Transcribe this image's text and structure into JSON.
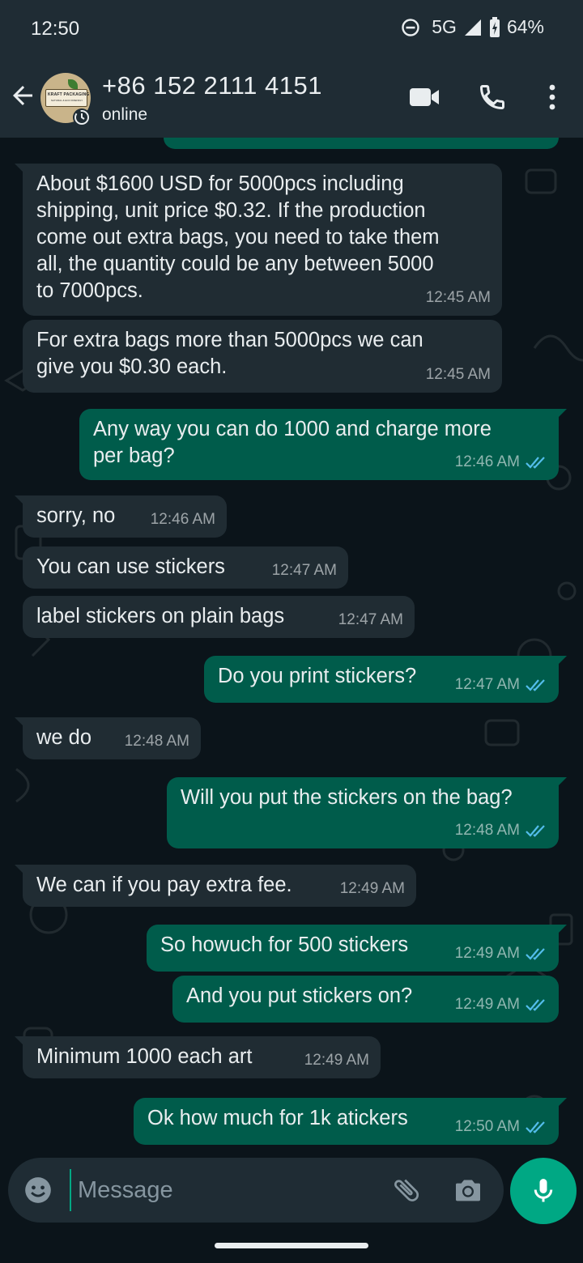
{
  "status_bar": {
    "time": "12:50",
    "network": "5G",
    "battery": "64%"
  },
  "header": {
    "contact_name": "+86 152 2111 4151",
    "contact_status": "online",
    "avatar_brand": "KRAFT PACKAGING",
    "avatar_tagline": "NATURAL & ECO FRIENDLY"
  },
  "messages": [
    {
      "direction": "in",
      "lines": [
        "About $1600 USD for 5000pcs including",
        "shipping, unit price $0.32. If the production",
        "come out extra bags, you need to take them",
        "all, the quantity could be any between 5000",
        "to 7000pcs."
      ],
      "time": "12:45 AM"
    },
    {
      "direction": "in",
      "lines": [
        "For extra bags more than 5000pcs we can",
        "give you $0.30 each."
      ],
      "time": "12:45 AM"
    },
    {
      "direction": "out",
      "lines": [
        "Any way you can do 1000 and charge more",
        "per bag?"
      ],
      "time": "12:46 AM",
      "read": true
    },
    {
      "direction": "in",
      "lines": [
        "sorry, no"
      ],
      "time": "12:46 AM"
    },
    {
      "direction": "in",
      "lines": [
        "You can use stickers"
      ],
      "time": "12:47 AM"
    },
    {
      "direction": "in",
      "lines": [
        "label stickers on plain bags"
      ],
      "time": "12:47 AM"
    },
    {
      "direction": "out",
      "lines": [
        "Do you print stickers?"
      ],
      "time": "12:47 AM",
      "read": true
    },
    {
      "direction": "in",
      "lines": [
        "we do"
      ],
      "time": "12:48 AM"
    },
    {
      "direction": "out",
      "lines": [
        "Will you put the stickers on the bag?"
      ],
      "time": "12:48 AM",
      "read": true
    },
    {
      "direction": "in",
      "lines": [
        "We can if you pay extra fee."
      ],
      "time": "12:49 AM"
    },
    {
      "direction": "out",
      "lines": [
        "So howuch for 500 stickers"
      ],
      "time": "12:49 AM",
      "read": true
    },
    {
      "direction": "out",
      "lines": [
        "And you put stickers on?"
      ],
      "time": "12:49 AM",
      "read": true
    },
    {
      "direction": "in",
      "lines": [
        "Minimum 1000 each art"
      ],
      "time": "12:49 AM"
    },
    {
      "direction": "out",
      "lines": [
        "Ok how much for 1k atickers"
      ],
      "time": "12:50 AM",
      "read": true
    }
  ],
  "composer": {
    "placeholder": "Message"
  },
  "colors": {
    "incoming_bubble": "#202c33",
    "outgoing_bubble": "#005c4b",
    "accent": "#00a884",
    "read_tick": "#53bdeb",
    "background": "#0b141a",
    "bar": "#1f2c34"
  },
  "icons": {
    "back": "arrow-left-icon",
    "video": "video-camera-icon",
    "call": "phone-icon",
    "more": "more-vertical-icon",
    "emoji": "emoji-icon",
    "attach": "paperclip-icon",
    "camera": "camera-icon",
    "mic": "microphone-icon"
  }
}
